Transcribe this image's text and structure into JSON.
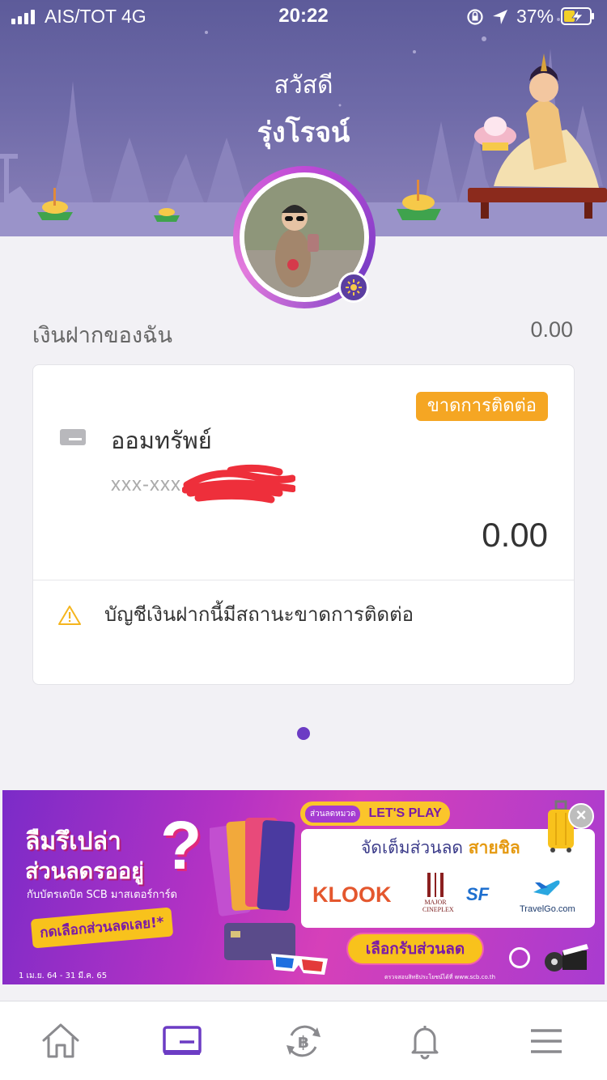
{
  "status_bar": {
    "carrier": "AIS/TOT  4G",
    "time": "20:22",
    "battery": "37%"
  },
  "header": {
    "greeting": "สวัสดี",
    "name": "รุ่งโรจน์"
  },
  "deposits": {
    "label": "เงินฝากของฉัน",
    "total": "0.00"
  },
  "account": {
    "status_badge": "ขาดการติดต่อ",
    "type": "ออมทรัพย์",
    "number": "xxx-xxx",
    "balance": "0.00",
    "warning": "บัญชีเงินฝากนี้มีสถานะขาดการติดต่อ"
  },
  "banner": {
    "title_line1": "ลืมรึเปล่า",
    "title_line2": "ส่วนลดรออยู่",
    "question_mark": "?",
    "subtitle": "กับบัตรเดบิต SCB มาสเตอร์การ์ด",
    "cta": "กดเลือกส่วนลดเลย!*",
    "date_range": "1 เม.ย. 64 - 31 มี.ค. 65",
    "tag": "ส่วนลดหมวด",
    "lets_play": "LET'S PLAY",
    "headline": "จัดเต็มส่วนลด",
    "headline_accent": "สายชิล",
    "partners": {
      "klook": "KLOOK",
      "major": "MAJOR CINEPLEX",
      "sf": "SF",
      "travelgo": "TravelGo.com"
    },
    "button": "เลือกรับส่วนลด",
    "close": "×",
    "fine_print": "ตรวจสอบสิทธิประโยชน์ได้ที่ www.scb.co.th"
  },
  "tabs": [
    "home",
    "accounts",
    "transfer",
    "notifications",
    "menu"
  ],
  "colors": {
    "primary": "#6c3cc4",
    "badge": "#f5a623",
    "header_bg": "#6e6aa8"
  }
}
